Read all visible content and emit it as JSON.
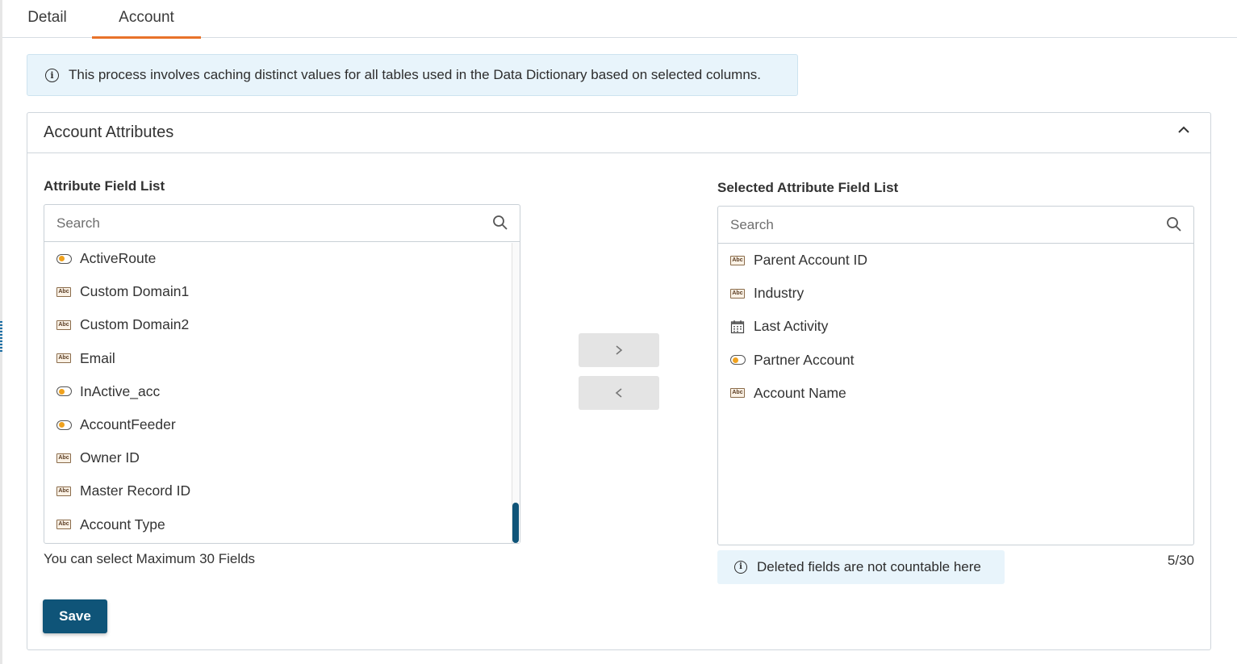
{
  "tabs": [
    {
      "label": "Detail",
      "active": false
    },
    {
      "label": "Account",
      "active": true
    }
  ],
  "info_banner": {
    "icon": "info-icon",
    "text": "This process involves caching distinct values for all tables used in the Data Dictionary based on selected columns."
  },
  "section": {
    "title": "Account Attributes",
    "collapse_icon": "chevron-up-icon"
  },
  "available_list": {
    "title": "Attribute Field List",
    "search_placeholder": "Search",
    "items": [
      {
        "label": "ActiveRoute",
        "icon": "toggle-icon"
      },
      {
        "label": "Custom Domain1",
        "icon": "text-abc-icon"
      },
      {
        "label": "Custom Domain2",
        "icon": "text-abc-icon"
      },
      {
        "label": "Email",
        "icon": "text-abc-icon"
      },
      {
        "label": "InActive_acc",
        "icon": "toggle-icon"
      },
      {
        "label": "AccountFeeder",
        "icon": "toggle-icon"
      },
      {
        "label": "Owner ID",
        "icon": "text-abc-icon"
      },
      {
        "label": "Master Record ID",
        "icon": "text-abc-icon"
      },
      {
        "label": "Account Type",
        "icon": "text-abc-icon"
      }
    ],
    "hint": "You can select Maximum 30 Fields"
  },
  "selected_list": {
    "title": "Selected Attribute Field List",
    "search_placeholder": "Search",
    "items": [
      {
        "label": "Parent Account ID",
        "icon": "text-abc-icon"
      },
      {
        "label": "Industry",
        "icon": "text-abc-icon"
      },
      {
        "label": "Last Activity",
        "icon": "calendar-icon"
      },
      {
        "label": "Partner Account",
        "icon": "toggle-icon"
      },
      {
        "label": "Account Name",
        "icon": "text-abc-icon"
      }
    ],
    "note": "Deleted fields are not countable here",
    "counter": "5/30"
  },
  "buttons": {
    "move_right_icon": "chevron-right-icon",
    "move_left_icon": "chevron-left-icon",
    "save": "Save"
  },
  "colors": {
    "primary": "#0f5478",
    "tab_accent": "#e8722a",
    "info_bg": "#e8f4fb",
    "toggle_knob": "#f0a21e"
  }
}
